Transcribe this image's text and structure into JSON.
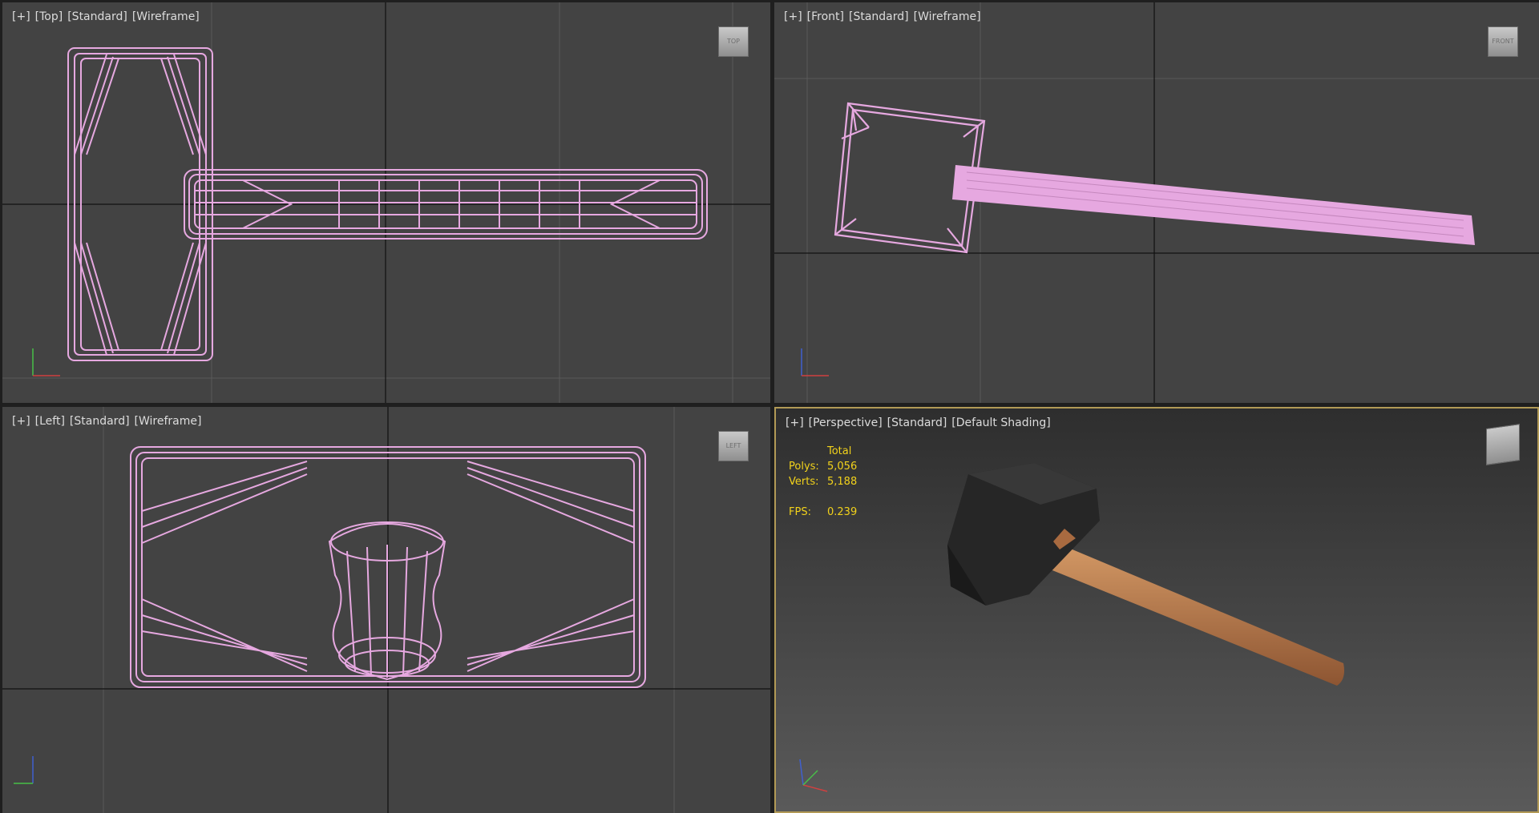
{
  "viewports": {
    "top": {
      "label_plus": "[+]",
      "label_view": "[Top]",
      "label_std": "[Standard]",
      "label_shading": "[Wireframe]",
      "cube": "TOP"
    },
    "front": {
      "label_plus": "[+]",
      "label_view": "[Front]",
      "label_std": "[Standard]",
      "label_shading": "[Wireframe]",
      "cube": "FRONT"
    },
    "left": {
      "label_plus": "[+]",
      "label_view": "[Left]",
      "label_std": "[Standard]",
      "label_shading": "[Wireframe]",
      "cube": "LEFT"
    },
    "perspective": {
      "label_plus": "[+]",
      "label_view": "[Perspective]",
      "label_std": "[Standard]",
      "label_shading": "[Default Shading]"
    }
  },
  "stats": {
    "header": "Total",
    "polys_label": "Polys:",
    "polys_value": "5,056",
    "verts_label": "Verts:",
    "verts_value": "5,188",
    "fps_label": "FPS:",
    "fps_value": "0.239"
  },
  "colors": {
    "wire": "#e6a8e0",
    "viewport_bg": "#434343",
    "grid": "#5a5a5a",
    "stats": "#f2d21b",
    "active_border": "#b29a56",
    "handle": "#b9784a",
    "head": "#262626"
  }
}
